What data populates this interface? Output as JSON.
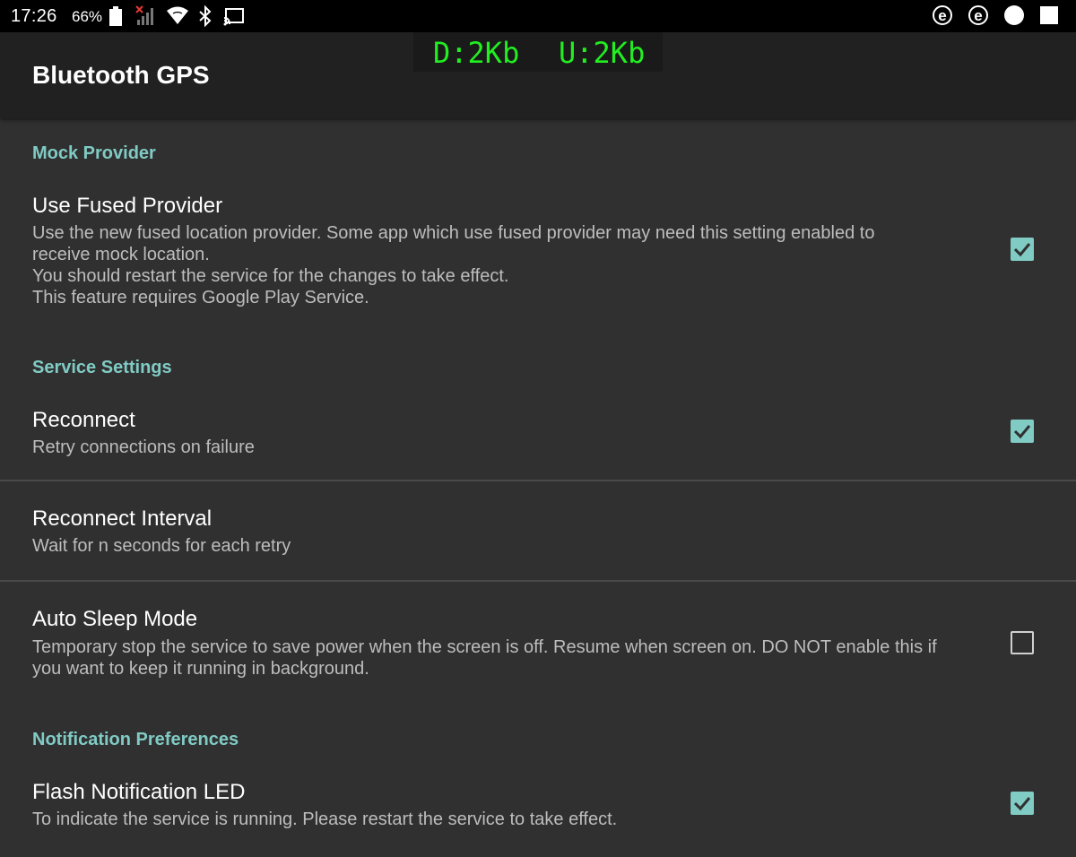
{
  "status_bar": {
    "time": "17:26",
    "battery": "66%",
    "icons": [
      "battery-icon",
      "signal-icon",
      "wifi-icon",
      "bluetooth-icon",
      "cast-icon",
      "e-app-icon",
      "e-app-icon",
      "circle-icon",
      "square-icon"
    ],
    "e_letter": "e"
  },
  "toolbar": {
    "title": "Bluetooth GPS"
  },
  "traffic": {
    "download": "D:2Kb",
    "upload": "U:2Kb"
  },
  "colors": {
    "accent": "#80cbc4",
    "background": "#303030",
    "toolbar": "#212121",
    "traffic_text": "#22ee22"
  },
  "categories": {
    "mock_provider": "Mock Provider",
    "service_settings": "Service Settings",
    "notification_preferences": "Notification Preferences"
  },
  "prefs": {
    "use_fused": {
      "title": "Use Fused Provider",
      "summary_1": "Use the new fused location provider.  Some app which use fused provider may need this setting enabled to",
      "summary_2": "receive mock location.",
      "summary_3": "You should restart the service for the changes to take effect.",
      "summary_4": "This feature requires Google Play Service.",
      "checked": true
    },
    "reconnect": {
      "title": "Reconnect",
      "summary": "Retry connections on failure",
      "checked": true
    },
    "reconnect_interval": {
      "title": "Reconnect Interval",
      "summary": "Wait for n seconds for each retry"
    },
    "auto_sleep": {
      "title": "Auto Sleep Mode",
      "summary_1": "Temporary stop the service to save power when the screen is off. Resume when screen on. DO NOT enable this if",
      "summary_2": "you want to keep it running in background.",
      "checked": false
    },
    "flash_led": {
      "title": "Flash Notification LED",
      "summary": "To indicate the service is running. Please restart the service to take effect.",
      "checked": true
    }
  }
}
